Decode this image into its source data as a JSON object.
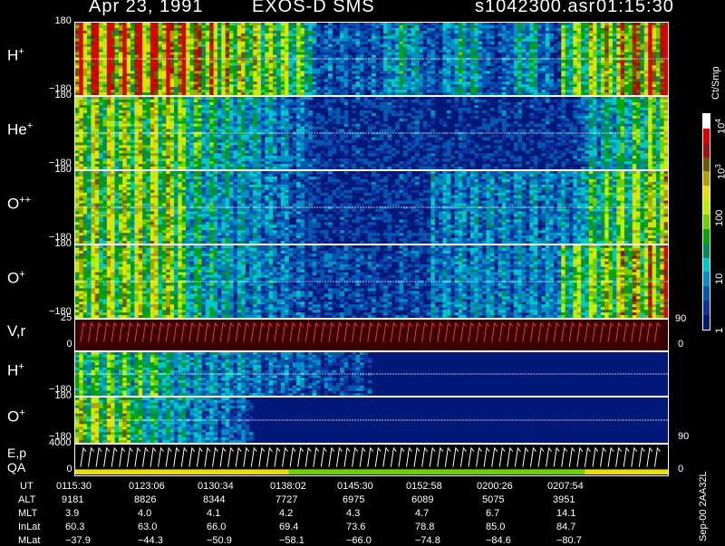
{
  "header": {
    "date": "Apr 23, 1991",
    "mission": "EXOS-D SMS",
    "file": "s1042300.asr",
    "time": "01:15:30"
  },
  "colorbar": {
    "unit": "Ct/Smp",
    "labels": [
      "10",
      "10",
      "100",
      "10",
      "1"
    ],
    "label_sup": [
      "4",
      "3",
      "",
      "",
      ""
    ],
    "colors": [
      "#ffffff",
      "#e00000",
      "#a01010",
      "#6b5a00",
      "#b0a000",
      "#e8e000",
      "#b8f000",
      "#70d000",
      "#00a800",
      "#008a60",
      "#00c8c8",
      "#0090c8",
      "#0058b0",
      "#1030a0",
      "#001878"
    ]
  },
  "panels": [
    {
      "label": "H",
      "sup": "+",
      "tick_top": "180",
      "tick_bottom": "−180"
    },
    {
      "label": "He",
      "sup": "+",
      "tick_top": "180",
      "tick_bottom": "−180"
    },
    {
      "label": "O",
      "sup": "++",
      "tick_top": "180",
      "tick_bottom": "−180"
    },
    {
      "label": "O",
      "sup": "+",
      "tick_top": "180",
      "tick_bottom": "−180"
    },
    {
      "label": "V",
      "sub": ",r",
      "tick_top": "25",
      "tick_bottom": "0",
      "right_top": "90",
      "right_bottom": "0"
    },
    {
      "label": "H",
      "sup": "+",
      "tick_top": "",
      "tick_bottom": "−180"
    },
    {
      "label": "O",
      "sup": "+",
      "tick_top": "180",
      "tick_bottom": "−180",
      "right_bottom": "90"
    },
    {
      "label": "E,p",
      "label2": "QA",
      "tick_top": "4000",
      "tick_bottom": "0",
      "right_bottom": "0"
    }
  ],
  "ephemeris": {
    "rows": [
      {
        "name": "UT",
        "values": [
          "0115:30",
          "0123:06",
          "0130:34",
          "0138:02",
          "0145:30",
          "0152:58",
          "0200:26",
          "0207:54"
        ]
      },
      {
        "name": "ALT",
        "values": [
          "9181",
          "8826",
          "8344",
          "7727",
          "6975",
          "6089",
          "5075",
          "3951"
        ]
      },
      {
        "name": "MLT",
        "values": [
          "3.9",
          "4.0",
          "4.1",
          "4.2",
          "4.3",
          "4.7",
          "6.7",
          "14.1"
        ]
      },
      {
        "name": "InLat",
        "values": [
          "60.3",
          "63.0",
          "66.0",
          "69.4",
          "73.6",
          "78.8",
          "85.0",
          "84.7"
        ]
      },
      {
        "name": "MLat",
        "values": [
          "−37.9",
          "−44.3",
          "−50.9",
          "−58.1",
          "−66.0",
          "−74.8",
          "−84.6",
          "−80.7"
        ]
      }
    ]
  },
  "footer": {
    "version": "Sep-00  2AA32L"
  },
  "chart_data": {
    "type": "heatmap",
    "title": "Apr 23, 1991   EXOS-D SMS",
    "x": [
      "0115:30",
      "0123:06",
      "0130:34",
      "0138:02",
      "0145:30",
      "0152:58",
      "0200:26",
      "0207:54"
    ],
    "ylabel_unit": "Ct/Smp",
    "colorbar_range": [
      1,
      10000
    ],
    "log_scale": true,
    "series": [
      {
        "name": "H+",
        "ylim": [
          -180,
          180
        ]
      },
      {
        "name": "He+",
        "ylim": [
          -180,
          180
        ]
      },
      {
        "name": "O++",
        "ylim": [
          -180,
          180
        ]
      },
      {
        "name": "O+",
        "ylim": [
          -180,
          180
        ]
      },
      {
        "name": "V,r",
        "ylim": [
          0,
          25
        ]
      },
      {
        "name": "H+",
        "ylim": [
          -180,
          180
        ]
      },
      {
        "name": "O+",
        "ylim": [
          -180,
          180
        ]
      },
      {
        "name": "E,p",
        "ylim": [
          0,
          4000
        ]
      }
    ]
  }
}
